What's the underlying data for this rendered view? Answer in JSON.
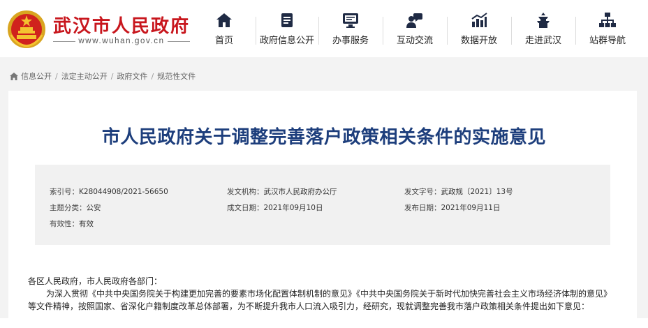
{
  "header": {
    "site_title": "武汉市人民政府",
    "site_domain": "www.wuhan.gov.cn"
  },
  "nav": [
    {
      "label": "首页",
      "icon": "home-icon"
    },
    {
      "label": "政府信息公开",
      "icon": "document-icon"
    },
    {
      "label": "办事服务",
      "icon": "monitor-service-icon"
    },
    {
      "label": "互动交流",
      "icon": "chat-person-icon"
    },
    {
      "label": "数据开放",
      "icon": "bar-chart-icon"
    },
    {
      "label": "走进武汉",
      "icon": "landmark-icon"
    },
    {
      "label": "站群导航",
      "icon": "sitemap-icon"
    }
  ],
  "breadcrumb": [
    "信息公开",
    "法定主动公开",
    "政府文件",
    "规范性文件"
  ],
  "document": {
    "title": "市人民政府关于调整完善落户政策相关条件的实施意见",
    "meta": {
      "index_no_label": "索引号：",
      "index_no": "K28044908/2021-56650",
      "issuer_label": "发文机构：",
      "issuer": "武汉市人民政府办公厅",
      "doc_no_label": "发文字号：",
      "doc_no": "武政规〔2021〕13号",
      "category_label": "主题分类：",
      "category": "公安",
      "created_label": "成文日期：",
      "created": "2021年09月10日",
      "published_label": "发布日期：",
      "published": "2021年09月11日",
      "validity_label": "有效性：",
      "validity": "有效"
    },
    "salutation": "各区人民政府，市人民政府各部门：",
    "para1_line1": "为深入贯彻《中共中央国务院关于构建更加完善的要素市场化配置体制机制的意见》《中共中央国务院关于新时代加快完善社会主义市场经济体制的意见》",
    "para1_line2": "等文件精神，按照国家、省深化户籍制度改革总体部署，为不断提升我市人口流入吸引力，经研究，现就调整完善我市落户政策相关条件提出如下意见："
  },
  "colors": {
    "brand_red": "#c8161d",
    "title_blue": "#1d3e7c",
    "nav_icon": "#1f2a44",
    "page_bg": "#f3f3f3"
  }
}
